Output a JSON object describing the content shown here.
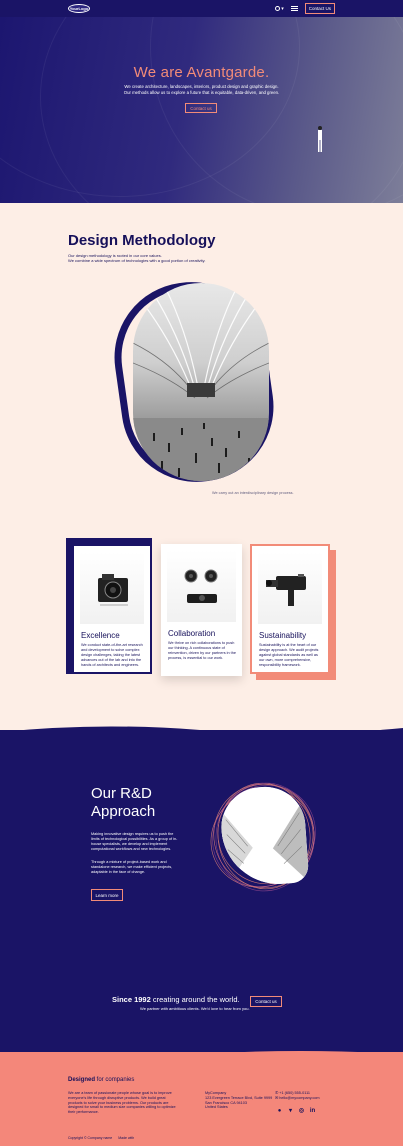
{
  "nav": {
    "logo": "YourLogo",
    "lang": "▾",
    "contact_label": "Contact Us"
  },
  "hero": {
    "title": "We are Avantgarde.",
    "subtitle_1": "We create architecture, landscapes, interiors, product design and graphic design.",
    "subtitle_2": "Our methods allow us to explore a future that is equitable, data-driven, and green.",
    "button": "Contact us"
  },
  "methodology": {
    "title": "Design Methodology",
    "line1": "Our design methodology is rooted in our core values.",
    "line2": "We combine a wide spectrum of technologies with a good portion of creativity.",
    "caption": "We carry out an interdisciplinary design process."
  },
  "cards": [
    {
      "title": "Excellence",
      "text": "We conduct state-of-the-art research and development to solve complex design challenges, taking the latest advances out of the lab and into the hands of architects and engineers."
    },
    {
      "title": "Collaboration",
      "text": "We thrive on rich collaborations to push our thinking. A continuous state of reinvention, driven by our partners in the process, is essential to our work."
    },
    {
      "title": "Sustainability",
      "text": "Sustainability is at the heart of our design approach. We audit projects against global standards as well as our own, more comprehensive, responsibility framework."
    }
  ],
  "rd": {
    "title_1": "Our R&D",
    "title_2": "Approach",
    "p1": "Making innovative design requires us to push the limits of technological possibilities. As a group of in-house specialists, we develop and implement computational workflows and new technologies.",
    "p2": "Through a mixture of project-based work and standalone research, we make efficient projects, adaptable in the face of change.",
    "button": "Learn more"
  },
  "since": {
    "bold": "Since 1992",
    "rest": " creating around the world.",
    "sub": "We partner with ambitious clients. We'd love to hear from you.",
    "button": "Contact us"
  },
  "footer": {
    "title_bold": "Designed",
    "title_rest": " for companies",
    "desc": "We are a team of passionate people whose goal is to improve everyone's life through disruptive products. We build great products to solve your business problems. Our products are designed for small to medium size companies willing to optimize their performance.",
    "addr_1": "MyCompany",
    "addr_2": "123 Evergreen Terrace Blvd, Suite 9999",
    "addr_3": "San Francisco CA 94103",
    "addr_4": "United States",
    "phone": "+1 (650) 555-0111",
    "email": "hello@mycompany.com",
    "copyright": "Copyright © Company name",
    "made_with": "Made with"
  },
  "colors": {
    "navy": "#1a1466",
    "coral": "#f28b78",
    "cream": "#fdeee6",
    "footer": "#f4877a"
  }
}
